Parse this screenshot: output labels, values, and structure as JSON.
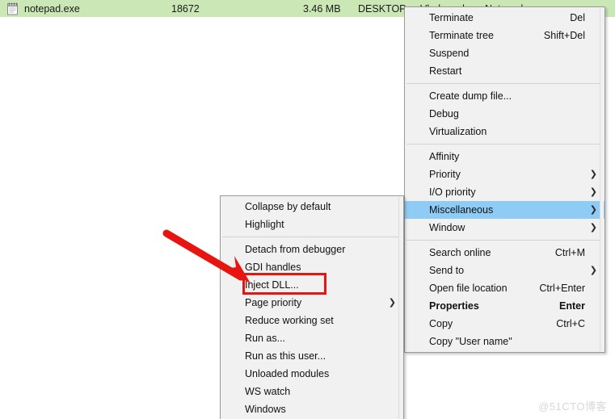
{
  "process_row": {
    "icon": "notepad-icon",
    "name": "notepad.exe",
    "pid": "18672",
    "memory": "3.46 MB",
    "user_part1": "DESKTOP",
    "user_part2": "Vlad.-.web",
    "description": "Notepad",
    "row_color": "#cbe7b5"
  },
  "context_menu": {
    "items": [
      {
        "label": "Terminate",
        "accel": "Del",
        "submenu": false,
        "separator_after": false
      },
      {
        "label": "Terminate tree",
        "accel": "Shift+Del",
        "submenu": false,
        "separator_after": false
      },
      {
        "label": "Suspend",
        "accel": "",
        "submenu": false,
        "separator_after": false
      },
      {
        "label": "Restart",
        "accel": "",
        "submenu": false,
        "separator_after": true
      },
      {
        "label": "Create dump file...",
        "accel": "",
        "submenu": false,
        "separator_after": false
      },
      {
        "label": "Debug",
        "accel": "",
        "submenu": false,
        "separator_after": false
      },
      {
        "label": "Virtualization",
        "accel": "",
        "submenu": false,
        "separator_after": true
      },
      {
        "label": "Affinity",
        "accel": "",
        "submenu": false,
        "separator_after": false
      },
      {
        "label": "Priority",
        "accel": "",
        "submenu": true,
        "separator_after": false
      },
      {
        "label": "I/O priority",
        "accel": "",
        "submenu": true,
        "separator_after": false
      },
      {
        "label": "Miscellaneous",
        "accel": "",
        "submenu": true,
        "separator_after": false,
        "selected": true
      },
      {
        "label": "Window",
        "accel": "",
        "submenu": true,
        "separator_after": true
      },
      {
        "label": "Search online",
        "accel": "Ctrl+M",
        "submenu": false,
        "separator_after": false
      },
      {
        "label": "Send to",
        "accel": "",
        "submenu": true,
        "separator_after": false
      },
      {
        "label": "Open file location",
        "accel": "Ctrl+Enter",
        "submenu": false,
        "separator_after": false
      },
      {
        "label": "Properties",
        "accel": "Enter",
        "submenu": false,
        "separator_after": false,
        "bold": true
      },
      {
        "label": "Copy",
        "accel": "Ctrl+C",
        "submenu": false,
        "separator_after": false
      },
      {
        "label": "Copy \"User name\"",
        "accel": "",
        "submenu": false,
        "separator_after": false
      }
    ]
  },
  "submenu": {
    "items": [
      {
        "label": "Collapse by default",
        "accel": "",
        "submenu": false,
        "separator_after": false
      },
      {
        "label": "Highlight",
        "accel": "",
        "submenu": false,
        "separator_after": true
      },
      {
        "label": "Detach from debugger",
        "accel": "",
        "submenu": false,
        "separator_after": false
      },
      {
        "label": "GDI handles",
        "accel": "",
        "submenu": false,
        "separator_after": false
      },
      {
        "label": "Inject DLL...",
        "accel": "",
        "submenu": false,
        "separator_after": false,
        "highlighted": true
      },
      {
        "label": "Page priority",
        "accel": "",
        "submenu": true,
        "separator_after": false
      },
      {
        "label": "Reduce working set",
        "accel": "",
        "submenu": false,
        "separator_after": false
      },
      {
        "label": "Run as...",
        "accel": "",
        "submenu": false,
        "separator_after": false
      },
      {
        "label": "Run as this user...",
        "accel": "",
        "submenu": false,
        "separator_after": false
      },
      {
        "label": "Unloaded modules",
        "accel": "",
        "submenu": false,
        "separator_after": false
      },
      {
        "label": "WS watch",
        "accel": "",
        "submenu": false,
        "separator_after": false
      },
      {
        "label": "Windows",
        "accel": "",
        "submenu": false,
        "separator_after": false
      }
    ]
  },
  "annotations": {
    "arrow_color": "#e8140f",
    "box_color": "#e8140f",
    "box_target": "Inject DLL..."
  },
  "watermark": {
    "text": "@51CTO博客"
  },
  "colors": {
    "selection": "#8ecbf5",
    "menu_bg": "#f1f1f1",
    "row_green": "#cbe7b5",
    "accent_red": "#e8140f"
  }
}
